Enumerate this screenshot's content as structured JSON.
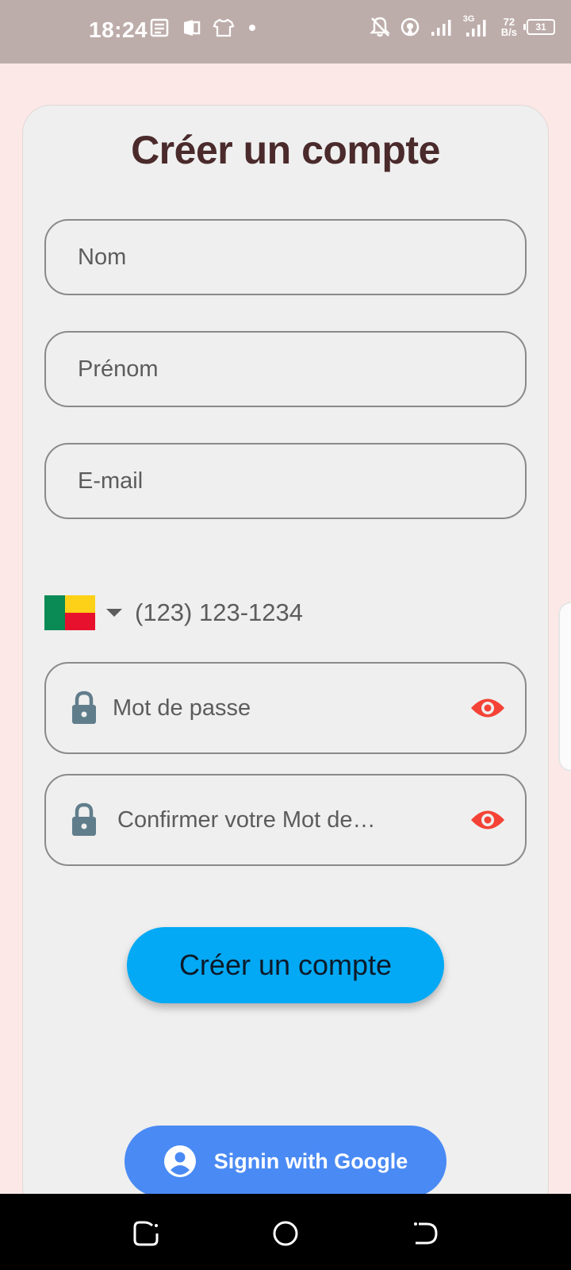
{
  "status_bar": {
    "time": "18:24",
    "net_speed_value": "72",
    "net_speed_unit": "B/s",
    "battery": "31",
    "network_type": "3G",
    "icons_left": [
      "news-icon",
      "office-icon",
      "tshirt-icon",
      "dot-icon"
    ],
    "icons_right": [
      "notifications-off-icon",
      "hotspot-icon",
      "signal-icon",
      "signal-3g-icon",
      "battery-icon"
    ]
  },
  "form": {
    "title": "Créer un compte",
    "nom_placeholder": "Nom",
    "prenom_placeholder": "Prénom",
    "email_placeholder": "E-mail",
    "phone_placeholder": "(123) 123-1234",
    "country_flag": "Benin",
    "password_placeholder": "Mot de passe",
    "confirm_password_placeholder": "Confirmer votre Mot de…",
    "create_button": "Créer un compte",
    "google_button": "Signin with Google"
  },
  "colors": {
    "background": "#fce9e7",
    "card": "#efefef",
    "title": "#4a2a2b",
    "primary_button": "#03a9f4",
    "google_button": "#4a8af4",
    "eye_icon": "#f44336",
    "lock_icon": "#607d8b"
  }
}
